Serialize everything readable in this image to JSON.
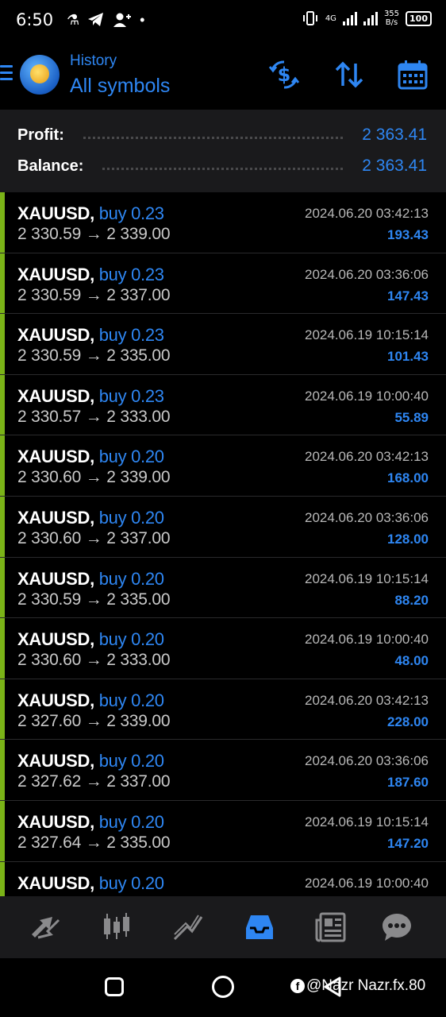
{
  "status_bar": {
    "time": "6:50",
    "net_type": "4G",
    "net_speed": "355",
    "net_speed_unit": "B/s",
    "battery": "100"
  },
  "header": {
    "subtitle": "History",
    "title": "All symbols",
    "icons": [
      "currency-exchange-icon",
      "sort-icon",
      "calendar-icon"
    ]
  },
  "summary": {
    "profit_label": "Profit:",
    "profit_value": "2 363.41",
    "balance_label": "Balance:",
    "balance_value": "2 363.41"
  },
  "trades": [
    {
      "symbol": "XAUUSD,",
      "direction": "buy 0.23",
      "prices": "2 330.59 → 2 339.00",
      "datetime": "2024.06.20 03:42:13",
      "profit": "193.43"
    },
    {
      "symbol": "XAUUSD,",
      "direction": "buy 0.23",
      "prices": "2 330.59 → 2 337.00",
      "datetime": "2024.06.20 03:36:06",
      "profit": "147.43"
    },
    {
      "symbol": "XAUUSD,",
      "direction": "buy 0.23",
      "prices": "2 330.59 → 2 335.00",
      "datetime": "2024.06.19 10:15:14",
      "profit": "101.43"
    },
    {
      "symbol": "XAUUSD,",
      "direction": "buy 0.23",
      "prices": "2 330.57 → 2 333.00",
      "datetime": "2024.06.19 10:00:40",
      "profit": "55.89"
    },
    {
      "symbol": "XAUUSD,",
      "direction": "buy 0.20",
      "prices": "2 330.60 → 2 339.00",
      "datetime": "2024.06.20 03:42:13",
      "profit": "168.00"
    },
    {
      "symbol": "XAUUSD,",
      "direction": "buy 0.20",
      "prices": "2 330.60 → 2 337.00",
      "datetime": "2024.06.20 03:36:06",
      "profit": "128.00"
    },
    {
      "symbol": "XAUUSD,",
      "direction": "buy 0.20",
      "prices": "2 330.59 → 2 335.00",
      "datetime": "2024.06.19 10:15:14",
      "profit": "88.20"
    },
    {
      "symbol": "XAUUSD,",
      "direction": "buy 0.20",
      "prices": "2 330.60 → 2 333.00",
      "datetime": "2024.06.19 10:00:40",
      "profit": "48.00"
    },
    {
      "symbol": "XAUUSD,",
      "direction": "buy 0.20",
      "prices": "2 327.60 → 2 339.00",
      "datetime": "2024.06.20 03:42:13",
      "profit": "228.00"
    },
    {
      "symbol": "XAUUSD,",
      "direction": "buy 0.20",
      "prices": "2 327.62 → 2 337.00",
      "datetime": "2024.06.20 03:36:06",
      "profit": "187.60"
    },
    {
      "symbol": "XAUUSD,",
      "direction": "buy 0.20",
      "prices": "2 327.64 → 2 335.00",
      "datetime": "2024.06.19 10:15:14",
      "profit": "147.20"
    },
    {
      "symbol": "XAUUSD,",
      "direction": "buy 0.20",
      "prices": "",
      "datetime": "2024.06.19 10:00:40",
      "profit": ""
    }
  ],
  "bottom_nav": [
    "quotes-icon",
    "chart-icon",
    "trade-icon",
    "history-icon",
    "news-icon",
    "messages-icon"
  ],
  "colors": {
    "accent": "#2e86f2",
    "buy_bar": "#7ab317",
    "panel": "#1a1a1c"
  },
  "watermark": "@Nazr Nazr.fx.80"
}
